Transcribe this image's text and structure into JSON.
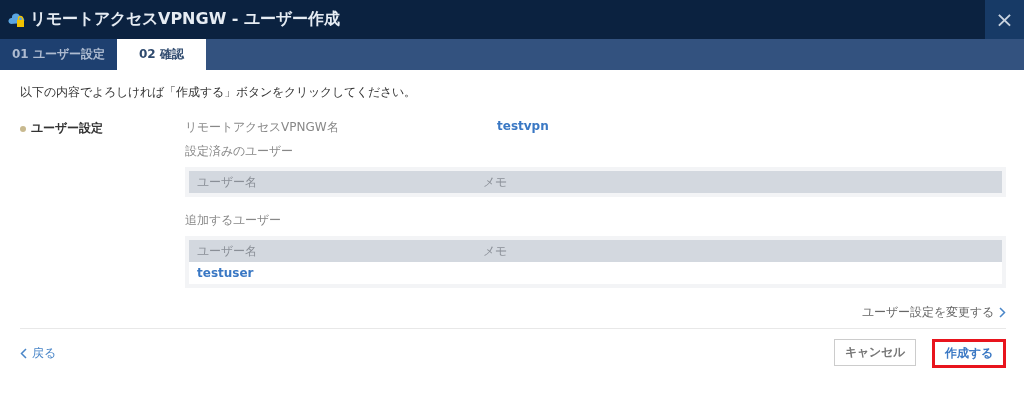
{
  "window": {
    "title": "リモートアクセスVPNGW - ユーザー作成",
    "close": "×"
  },
  "tabs": [
    {
      "label": "01 ユーザー設定",
      "selected": false
    },
    {
      "label": "02 確認",
      "selected": true
    }
  ],
  "instruction": "以下の内容でよろしければ「作成する」ボタンをクリックしてください。",
  "section": {
    "label": "ユーザー設定",
    "name_label": "リモートアクセスVPNGW名",
    "name_value": "testvpn",
    "tables": [
      {
        "title": "設定済みのユーザー",
        "columns": [
          "ユーザー名",
          "メモ"
        ]
      },
      {
        "title": "追加するユーザー",
        "columns": [
          "ユーザー名",
          "メモ"
        ],
        "rows": [
          [
            "testuser"
          ]
        ]
      }
    ],
    "change_link": "ユーザー設定を変更する"
  },
  "footer": {
    "back": "戻る",
    "cancel": "キャンセル",
    "create": {
      "label": "作成する",
      "highlighted": true
    }
  }
}
